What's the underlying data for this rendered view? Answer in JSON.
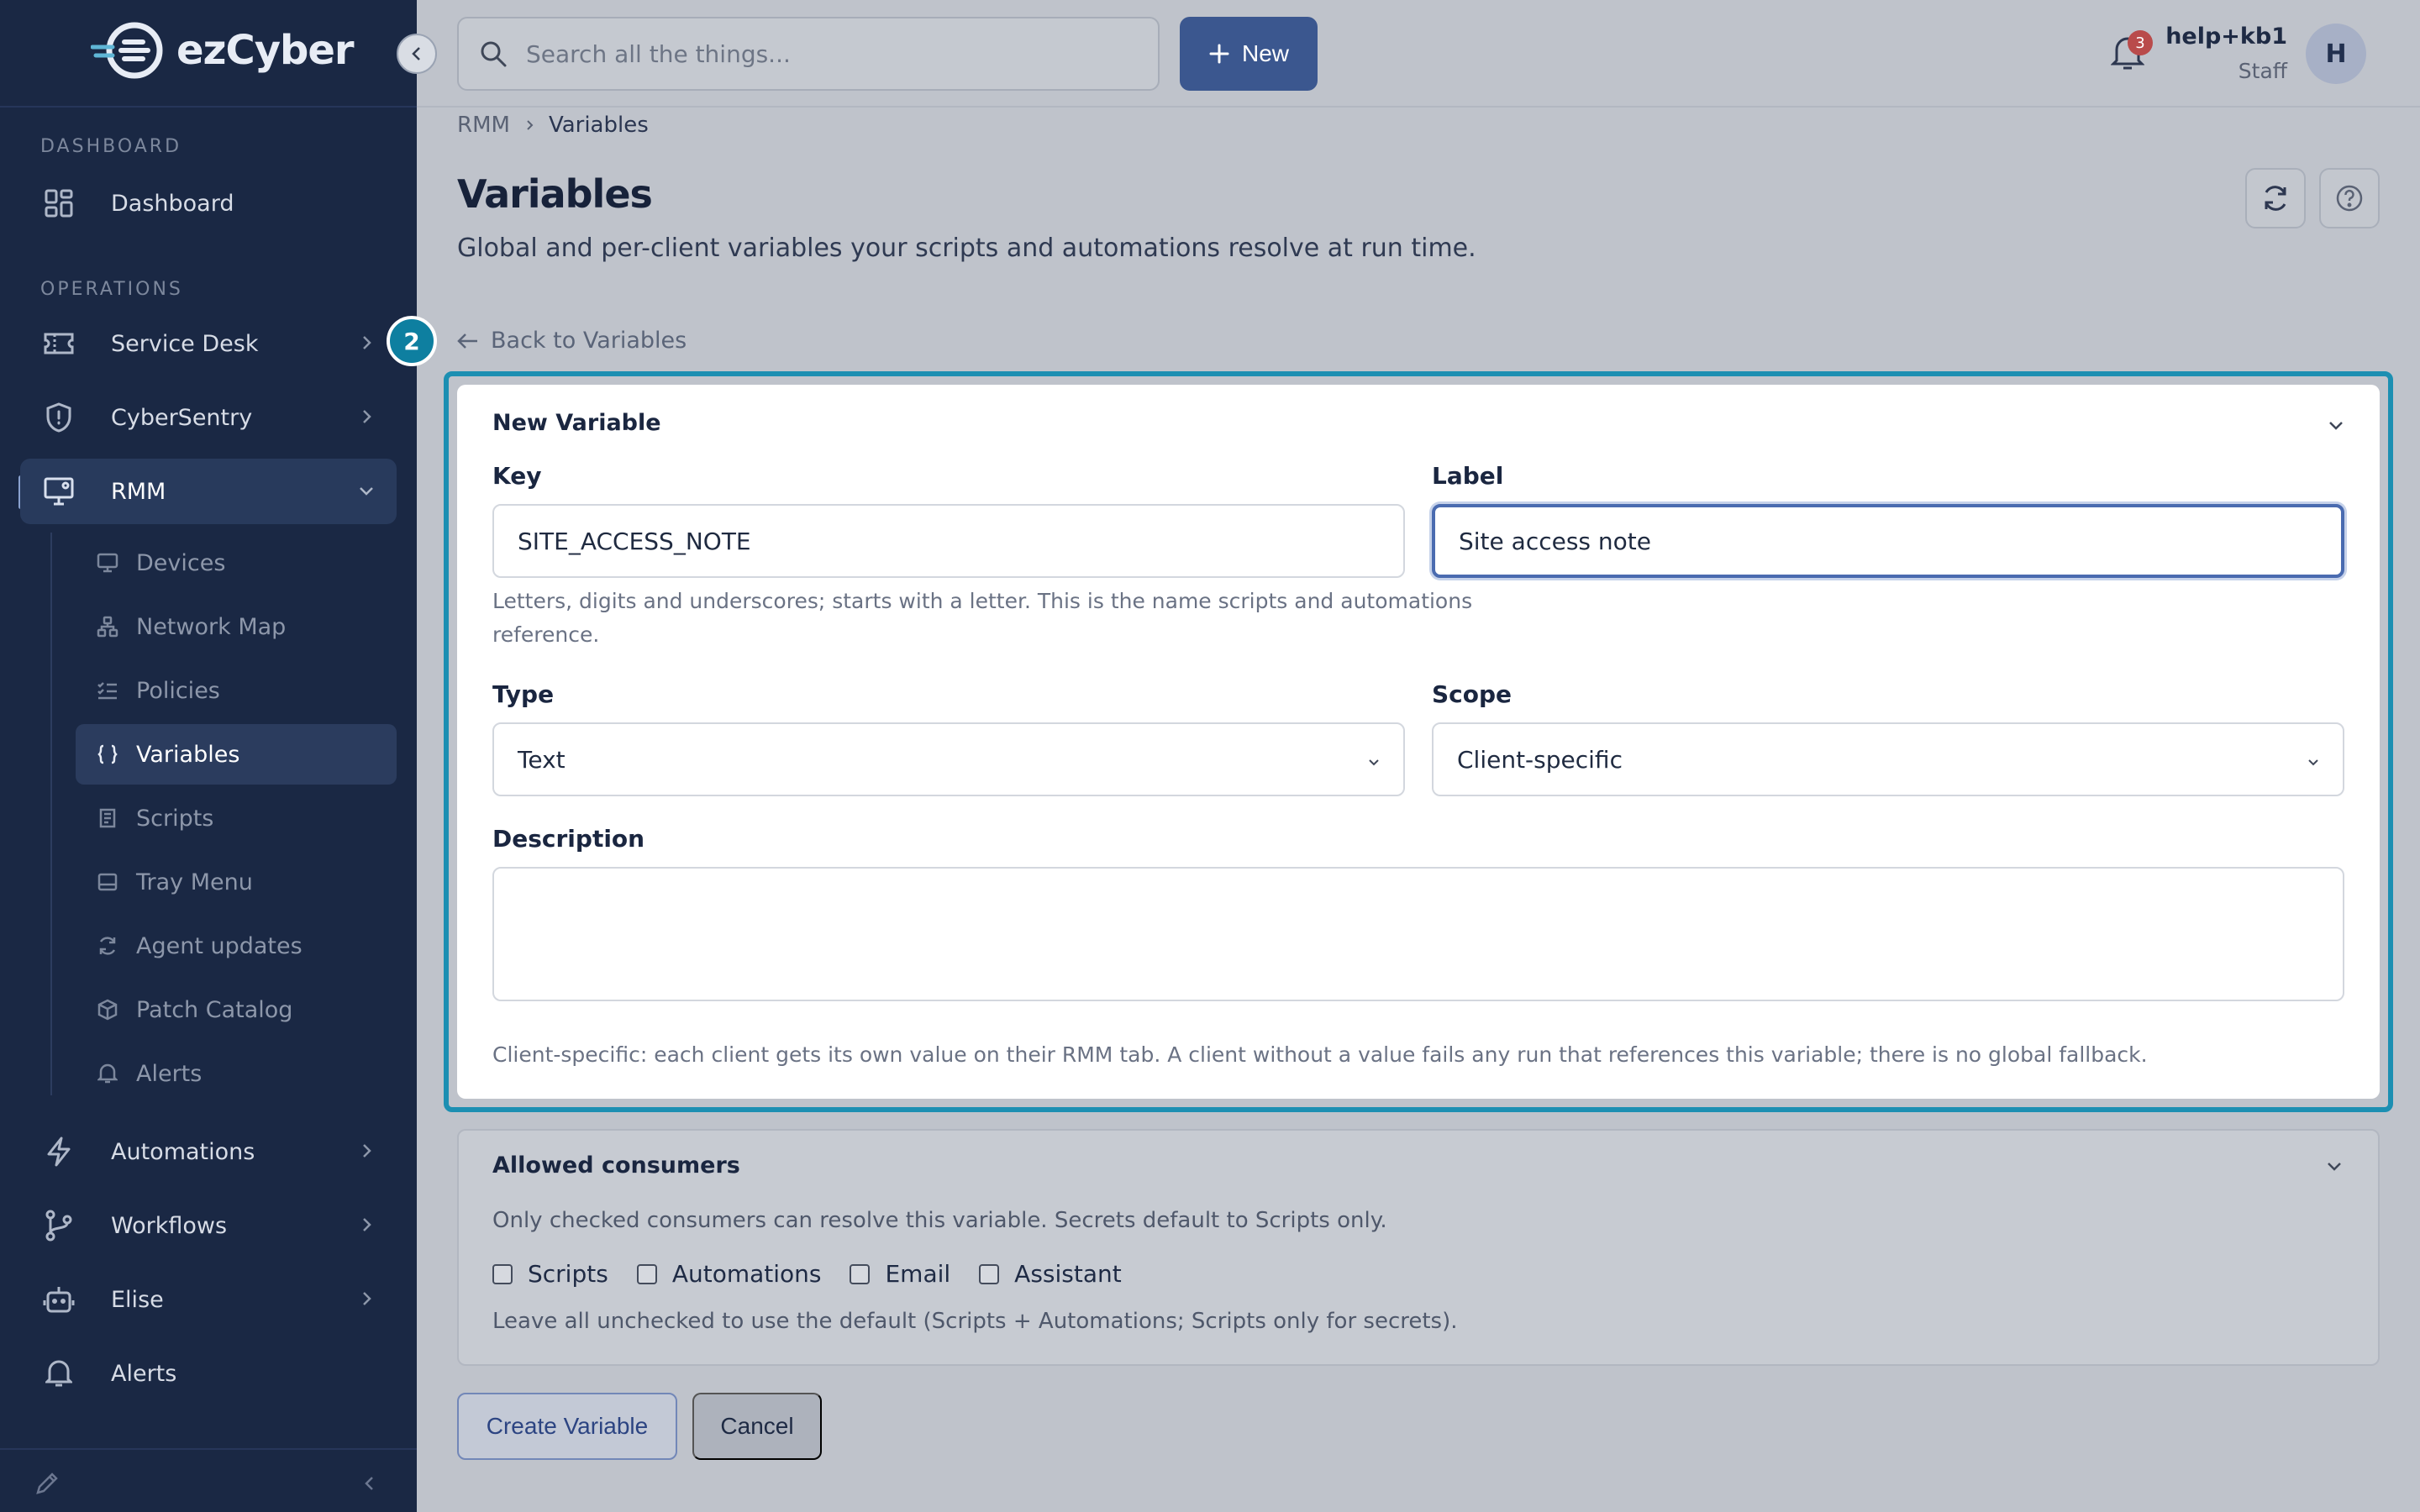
{
  "brand": {
    "name": "ezCyber"
  },
  "sidebar": {
    "sections": {
      "dashboard": "DASHBOARD",
      "operations": "OPERATIONS"
    },
    "items": {
      "dashboard": "Dashboard",
      "service_desk": "Service Desk",
      "cybersentry": "CyberSentry",
      "rmm": "RMM",
      "automations": "Automations",
      "workflows": "Workflows",
      "elise": "Elise",
      "alerts": "Alerts"
    },
    "rmm_sub": {
      "devices": "Devices",
      "network_map": "Network Map",
      "policies": "Policies",
      "variables": "Variables",
      "scripts": "Scripts",
      "tray_menu": "Tray Menu",
      "agent_updates": "Agent updates",
      "patch_catalog": "Patch Catalog",
      "alerts": "Alerts"
    }
  },
  "topbar": {
    "search_placeholder": "Search all the things...",
    "new_label": "New",
    "notification_count": "3",
    "user_name": "help+kb1",
    "user_role": "Staff",
    "avatar_initial": "H"
  },
  "breadcrumb": {
    "parent": "RMM",
    "current": "Variables"
  },
  "page": {
    "title": "Variables",
    "subtitle": "Global and per-client variables your scripts and automations resolve at run time.",
    "back_label": "Back to Variables",
    "step_number": "2"
  },
  "form": {
    "title": "New Variable",
    "key_label": "Key",
    "key_value": "SITE_ACCESS_NOTE",
    "key_help_line1": "Letters, digits and underscores; starts with a letter. This is the name scripts and automations",
    "key_help_line2": "reference.",
    "label_label": "Label",
    "label_value": "Site access note",
    "type_label": "Type",
    "type_value": "Text",
    "scope_label": "Scope",
    "scope_value": "Client-specific",
    "description_label": "Description",
    "description_value": "",
    "scope_help": "Client-specific: each client gets its own value on their RMM tab. A client without a value fails any run that references this variable; there is no global fallback."
  },
  "consumers": {
    "title": "Allowed consumers",
    "description": "Only checked consumers can resolve this variable. Secrets default to Scripts only.",
    "options": [
      "Scripts",
      "Automations",
      "Email",
      "Assistant"
    ],
    "footer": "Leave all unchecked to use the default (Scripts + Automations; Scripts only for secrets)."
  },
  "actions": {
    "create": "Create Variable",
    "cancel": "Cancel"
  },
  "colors": {
    "sidebar_bg": "#1a2844",
    "accent": "#3b578f",
    "highlight": "#1c8fb2",
    "badge": "#b94b4b"
  }
}
